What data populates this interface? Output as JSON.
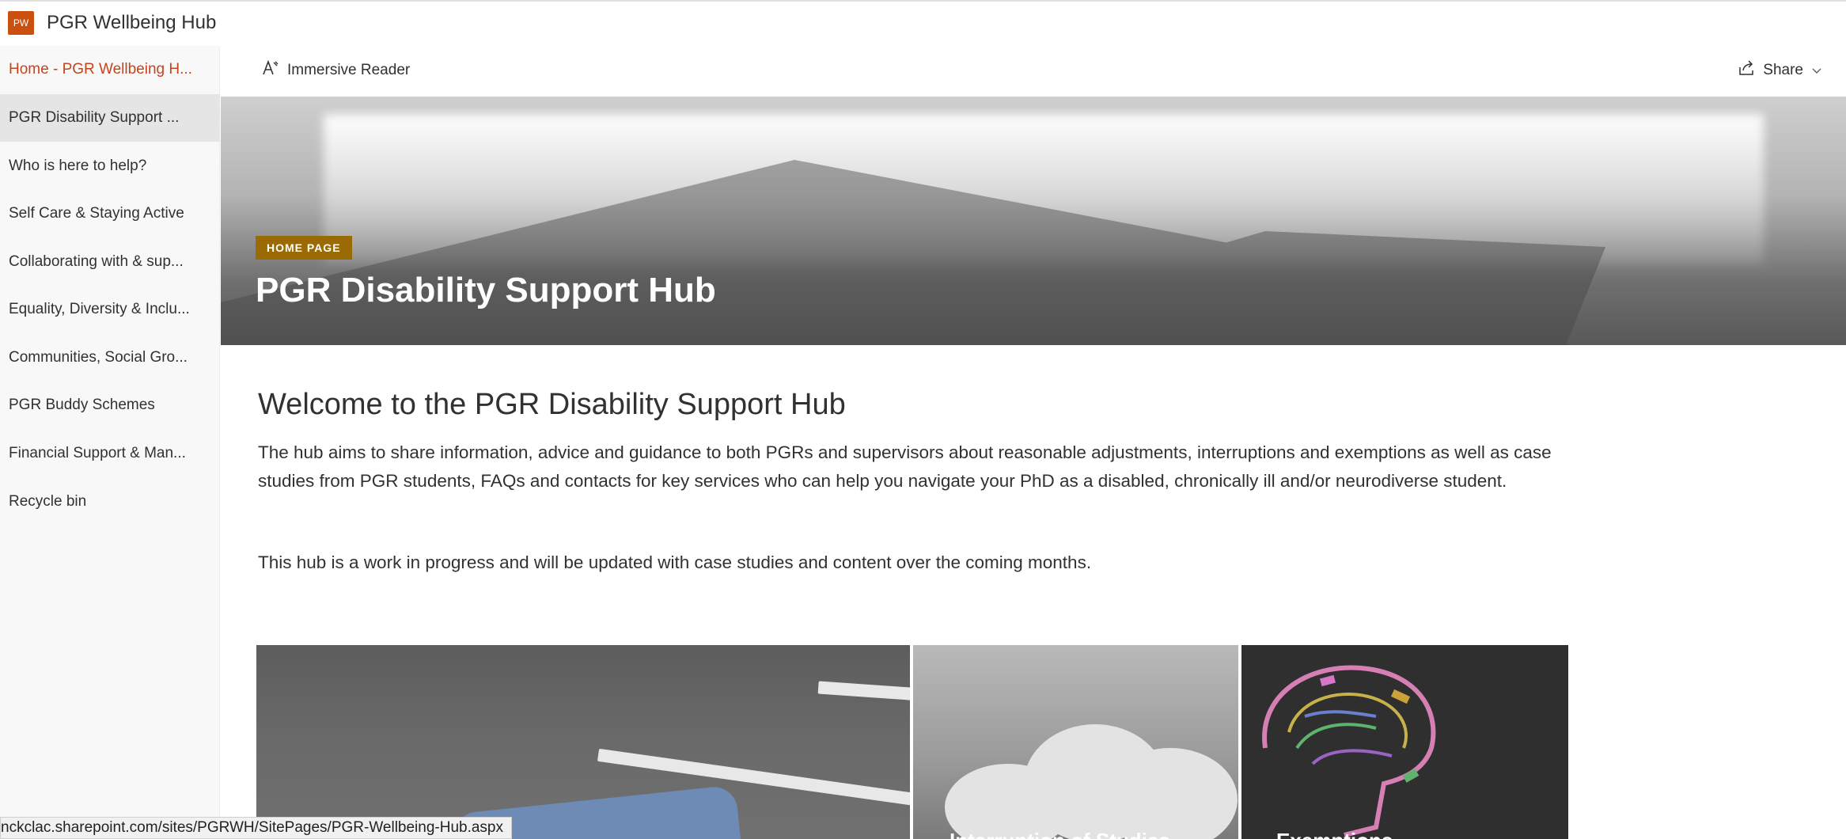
{
  "app": {
    "logo_text": "PW",
    "site_title": "PGR Wellbeing Hub",
    "accent_color": "#ca5010"
  },
  "nav": {
    "items": [
      {
        "label": "Home - PGR Wellbeing H...",
        "state": "active"
      },
      {
        "label": "PGR Disability Support ...",
        "state": "selected"
      },
      {
        "label": "Who is here to help?",
        "state": ""
      },
      {
        "label": "Self Care & Staying Active",
        "state": ""
      },
      {
        "label": "Collaborating with & sup...",
        "state": ""
      },
      {
        "label": "Equality, Diversity & Inclu...",
        "state": ""
      },
      {
        "label": "Communities, Social Gro...",
        "state": ""
      },
      {
        "label": "PGR Buddy Schemes",
        "state": ""
      },
      {
        "label": "Financial Support & Man...",
        "state": ""
      },
      {
        "label": "Recycle bin",
        "state": ""
      }
    ]
  },
  "toolbar": {
    "immersive_reader_label": "Immersive Reader",
    "share_label": "Share"
  },
  "hero": {
    "badge": "HOME PAGE",
    "title": "PGR Disability Support Hub"
  },
  "main": {
    "heading": "Welcome to the PGR Disability Support Hub",
    "paragraph1": "The hub aims to share information, advice and guidance to both PGRs and supervisors about reasonable adjustments, interruptions and exemptions as well as case studies from PGR students, FAQs and contacts for key services who can help you navigate your PhD as a disabled, chronically ill and/or neurodiverse student.",
    "paragraph2": "This hub is a work in progress and will be updated with case studies and content over the coming months."
  },
  "tiles": [
    {
      "label": ""
    },
    {
      "label": "Interruption of Studies"
    },
    {
      "label": "Exemptions"
    }
  ],
  "statusbar": {
    "url": "nckclac.sharepoint.com/sites/PGRWH/SitePages/PGR-Wellbeing-Hub.aspx"
  }
}
